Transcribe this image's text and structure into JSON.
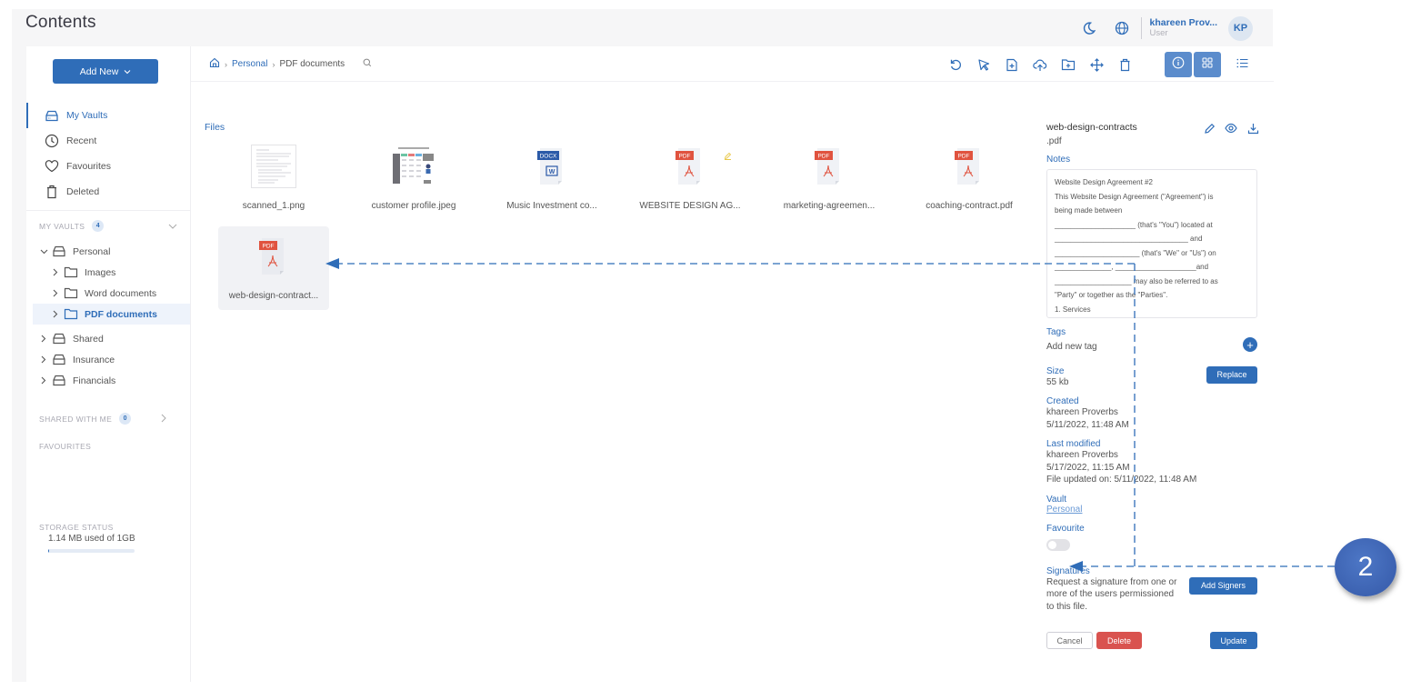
{
  "header": {
    "title": "Contents",
    "user_name": "khareen Prov...",
    "user_role": "User",
    "avatar_initials": "KP"
  },
  "sidebar": {
    "add_new_label": "Add New",
    "nav": [
      {
        "label": "My Vaults",
        "icon": "vault-icon",
        "active": true
      },
      {
        "label": "Recent",
        "icon": "clock-icon",
        "active": false
      },
      {
        "label": "Favourites",
        "icon": "heart-icon",
        "active": false
      },
      {
        "label": "Deleted",
        "icon": "trash-icon",
        "active": false
      }
    ],
    "my_vaults_label": "MY VAULTS",
    "my_vaults_count": "4",
    "tree": [
      {
        "label": "Personal",
        "level": 0,
        "expanded": true,
        "type": "vault"
      },
      {
        "label": "Images",
        "level": 1,
        "type": "folder"
      },
      {
        "label": "Word documents",
        "level": 1,
        "type": "folder"
      },
      {
        "label": "PDF documents",
        "level": 1,
        "type": "folder",
        "selected": true
      },
      {
        "label": "Shared",
        "level": 0,
        "type": "vault"
      },
      {
        "label": "Insurance",
        "level": 0,
        "type": "vault"
      },
      {
        "label": "Financials",
        "level": 0,
        "type": "vault"
      }
    ],
    "shared_with_me_label": "SHARED WITH ME",
    "shared_with_me_count": "0",
    "favourites_label": "FAVOURITES",
    "storage_label": "STORAGE STATUS",
    "storage_text": "1.14 MB used of 1GB",
    "storage_used_fraction": 0.0011
  },
  "toolbar": {
    "breadcrumb": [
      "Personal",
      "PDF documents"
    ],
    "tools": [
      "refresh-icon",
      "select-icon",
      "new-file-icon",
      "upload-icon",
      "new-folder-icon",
      "move-icon",
      "delete-icon"
    ],
    "views": [
      "info-view",
      "grid-view",
      "list-view"
    ]
  },
  "files": {
    "label": "Files",
    "items": [
      {
        "name": "scanned_1.png",
        "type": "image-doc"
      },
      {
        "name": "customer profile.jpeg",
        "type": "image-table"
      },
      {
        "name": "Music Investment co...",
        "type": "docx",
        "badge": "DOCX"
      },
      {
        "name": "WEBSITE DESIGN AG...",
        "type": "pdf",
        "badge": "PDF",
        "editing": true
      },
      {
        "name": "marketing-agreemen...",
        "type": "pdf",
        "badge": "PDF"
      },
      {
        "name": "coaching-contract.pdf",
        "type": "pdf",
        "badge": "PDF"
      },
      {
        "name": "web-design-contract...",
        "type": "pdf",
        "badge": "PDF",
        "selected": true
      }
    ]
  },
  "details": {
    "file_name": "web-design-contracts",
    "file_ext": ".pdf",
    "notes_label": "Notes",
    "notes": "Website Design Agreement #2\nThis Website Design Agreement (\"Agreement\") is\nbeing made between\n____________________ (that's \"You\") located at\n_________________________________ and\n_____________________ (that's \"We\" or \"Us\") on\n______________, ____________________and\n___________________ may also be referred to as\n\"Party\" or together as the \"Parties\".\n1. Services",
    "tags_label": "Tags",
    "tags_placeholder": "Add new tag",
    "size_label": "Size",
    "size_value": "55 kb",
    "replace_label": "Replace",
    "created_label": "Created",
    "created_by": "khareen Proverbs",
    "created_at": "5/11/2022, 11:48 AM",
    "modified_label": "Last modified",
    "modified_by": "khareen Proverbs",
    "modified_at": "5/17/2022, 11:15 AM",
    "file_updated": "File updated on: 5/11/2022, 11:48 AM",
    "vault_label": "Vault",
    "vault_value": "Personal",
    "favourite_label": "Favourite",
    "favourite_on": false,
    "signatures_label": "Signatures",
    "signatures_text": "Request a signature from one or more of the users permissioned to this file.",
    "add_signers_label": "Add Signers",
    "cancel_label": "Cancel",
    "delete_label": "Delete",
    "update_label": "Update"
  },
  "annotation": {
    "step_number": "2",
    "color": "#2f6db8"
  }
}
